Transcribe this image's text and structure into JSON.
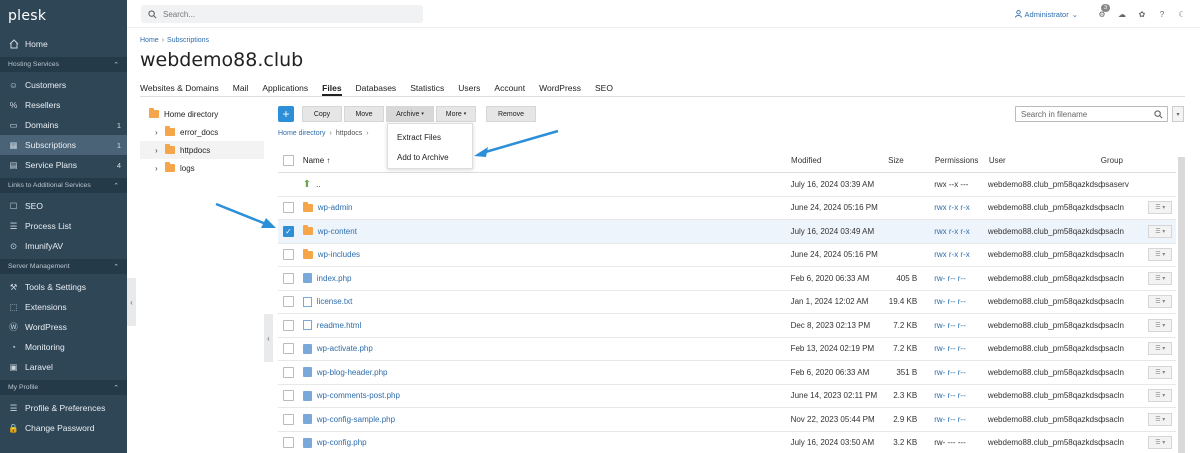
{
  "app": {
    "logo": "plesk"
  },
  "search": {
    "placeholder": "Search..."
  },
  "header": {
    "admin_label": "Administrator",
    "notif_count": "3"
  },
  "sidebar": {
    "home": "Home",
    "sections": [
      {
        "title": "Hosting Services",
        "items": [
          {
            "label": "Customers",
            "icon": "customers-icon",
            "count": ""
          },
          {
            "label": "Resellers",
            "icon": "resellers-icon",
            "count": ""
          },
          {
            "label": "Domains",
            "icon": "domains-icon",
            "count": "1"
          },
          {
            "label": "Subscriptions",
            "icon": "subscriptions-icon",
            "count": "1",
            "active": true
          },
          {
            "label": "Service Plans",
            "icon": "service-plans-icon",
            "count": "4"
          }
        ]
      },
      {
        "title": "Links to Additional Services",
        "items": [
          {
            "label": "SEO",
            "icon": "seo-icon",
            "count": ""
          },
          {
            "label": "Process List",
            "icon": "process-list-icon",
            "count": ""
          },
          {
            "label": "ImunifyAV",
            "icon": "imunify-icon",
            "count": ""
          }
        ]
      },
      {
        "title": "Server Management",
        "items": [
          {
            "label": "Tools & Settings",
            "icon": "tools-icon",
            "count": ""
          },
          {
            "label": "Extensions",
            "icon": "extensions-icon",
            "count": ""
          },
          {
            "label": "WordPress",
            "icon": "wordpress-icon",
            "count": ""
          },
          {
            "label": "Monitoring",
            "icon": "monitoring-icon",
            "count": ""
          },
          {
            "label": "Laravel",
            "icon": "laravel-icon",
            "count": ""
          }
        ]
      },
      {
        "title": "My Profile",
        "items": [
          {
            "label": "Profile & Preferences",
            "icon": "profile-icon",
            "count": ""
          },
          {
            "label": "Change Password",
            "icon": "password-icon",
            "count": ""
          }
        ]
      }
    ]
  },
  "breadcrumb": {
    "home": "Home",
    "subscriptions": "Subscriptions"
  },
  "page": {
    "title": "webdemo88.club"
  },
  "tabs": [
    "Websites & Domains",
    "Mail",
    "Applications",
    "Files",
    "Databases",
    "Statistics",
    "Users",
    "Account",
    "WordPress",
    "SEO"
  ],
  "active_tab": "Files",
  "tree": {
    "root": "Home directory",
    "items": [
      "error_docs",
      "httpdocs",
      "logs"
    ]
  },
  "toolbar": {
    "add": "+",
    "copy": "Copy",
    "move": "Move",
    "archive": "Archive",
    "more": "More",
    "remove": "Remove"
  },
  "file_search": {
    "placeholder": "Search in filename"
  },
  "file_breadcrumb": {
    "home": "Home directory",
    "current": "httpdocs"
  },
  "archive_menu": {
    "extract": "Extract Files",
    "add": "Add to Archive"
  },
  "table": {
    "headers": {
      "name": "Name ↑",
      "modified": "Modified",
      "size": "Size",
      "permissions": "Permissions",
      "user": "User",
      "group": "Group"
    },
    "rows": [
      {
        "name": "..",
        "type": "up",
        "modified": "July 16, 2024 03:39 AM",
        "size": "",
        "perm": "rwx --x ---",
        "user": "webdemo88.club_pm58qazkdsd",
        "group": "psaserv",
        "checked": false
      },
      {
        "name": "wp-admin",
        "type": "folder",
        "modified": "June 24, 2024 05:16 PM",
        "size": "",
        "perm": "rwx r-x r-x",
        "user": "webdemo88.club_pm58qazkdsd",
        "group": "psacln",
        "checked": false
      },
      {
        "name": "wp-content",
        "type": "folder",
        "modified": "July 16, 2024 03:49 AM",
        "size": "",
        "perm": "rwx r-x r-x",
        "user": "webdemo88.club_pm58qazkdsd",
        "group": "psacln",
        "checked": true
      },
      {
        "name": "wp-includes",
        "type": "folder",
        "modified": "June 24, 2024 05:16 PM",
        "size": "",
        "perm": "rwx r-x r-x",
        "user": "webdemo88.club_pm58qazkdsd",
        "group": "psacln",
        "checked": false
      },
      {
        "name": "index.php",
        "type": "doc",
        "modified": "Feb 6, 2020 06:33 AM",
        "size": "405 B",
        "perm": "rw- r-- r--",
        "user": "webdemo88.club_pm58qazkdsd",
        "group": "psacln",
        "checked": false
      },
      {
        "name": "license.txt",
        "type": "txt",
        "modified": "Jan 1, 2024 12:02 AM",
        "size": "19.4 KB",
        "perm": "rw- r-- r--",
        "user": "webdemo88.club_pm58qazkdsd",
        "group": "psacln",
        "checked": false
      },
      {
        "name": "readme.html",
        "type": "txt",
        "modified": "Dec 8, 2023 02:13 PM",
        "size": "7.2 KB",
        "perm": "rw- r-- r--",
        "user": "webdemo88.club_pm58qazkdsd",
        "group": "psacln",
        "checked": false
      },
      {
        "name": "wp-activate.php",
        "type": "doc",
        "modified": "Feb 13, 2024 02:19 PM",
        "size": "7.2 KB",
        "perm": "rw- r-- r--",
        "user": "webdemo88.club_pm58qazkdsd",
        "group": "psacln",
        "checked": false
      },
      {
        "name": "wp-blog-header.php",
        "type": "doc",
        "modified": "Feb 6, 2020 06:33 AM",
        "size": "351 B",
        "perm": "rw- r-- r--",
        "user": "webdemo88.club_pm58qazkdsd",
        "group": "psacln",
        "checked": false
      },
      {
        "name": "wp-comments-post.php",
        "type": "doc",
        "modified": "June 14, 2023 02:11 PM",
        "size": "2.3 KB",
        "perm": "rw- r-- r--",
        "user": "webdemo88.club_pm58qazkdsd",
        "group": "psacln",
        "checked": false
      },
      {
        "name": "wp-config-sample.php",
        "type": "doc",
        "modified": "Nov 22, 2023 05:44 PM",
        "size": "2.9 KB",
        "perm": "rw- r-- r--",
        "user": "webdemo88.club_pm58qazkdsd",
        "group": "psacln",
        "checked": false
      },
      {
        "name": "wp-config.php",
        "type": "doc",
        "modified": "July 16, 2024 03:50 AM",
        "size": "3.2 KB",
        "perm": "rw- --- ---",
        "user": "webdemo88.club_pm58qazkdsd",
        "group": "psacln",
        "checked": false
      }
    ]
  },
  "colors": {
    "sidebar": "#2f4657",
    "accent": "#2c8fd8",
    "link": "#2d6dac"
  }
}
